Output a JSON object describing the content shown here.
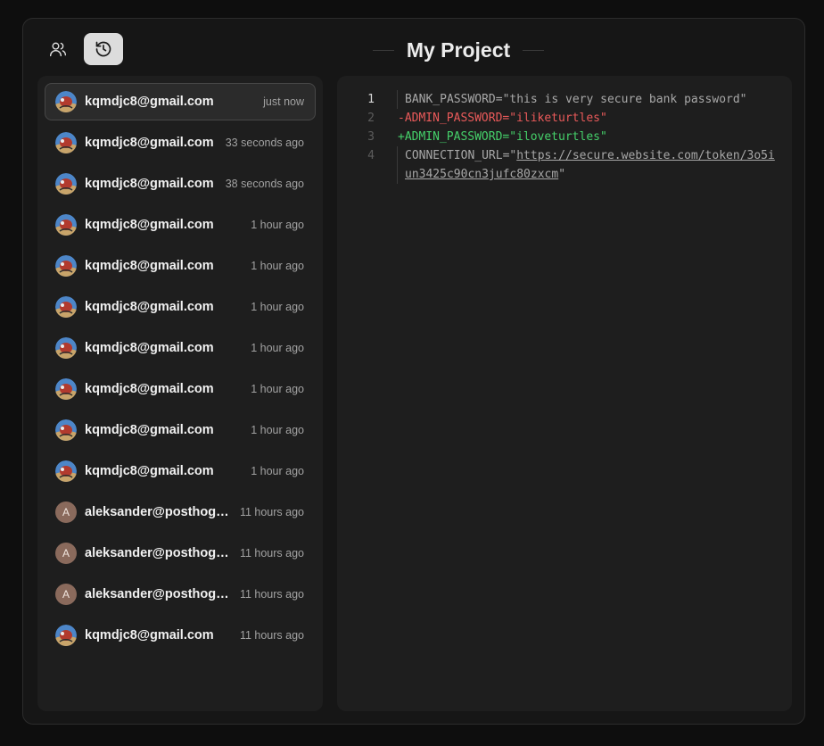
{
  "header": {
    "title": "My Project",
    "users_icon": "users-icon",
    "history_icon": "history-icon"
  },
  "history": {
    "items": [
      {
        "email": "kqmdjc8@gmail.com",
        "time": "just now",
        "avatar": "image",
        "active": true
      },
      {
        "email": "kqmdjc8@gmail.com",
        "time": "33 seconds ago",
        "avatar": "image"
      },
      {
        "email": "kqmdjc8@gmail.com",
        "time": "38 seconds ago",
        "avatar": "image"
      },
      {
        "email": "kqmdjc8@gmail.com",
        "time": "1 hour ago",
        "avatar": "image"
      },
      {
        "email": "kqmdjc8@gmail.com",
        "time": "1 hour ago",
        "avatar": "image"
      },
      {
        "email": "kqmdjc8@gmail.com",
        "time": "1 hour ago",
        "avatar": "image"
      },
      {
        "email": "kqmdjc8@gmail.com",
        "time": "1 hour ago",
        "avatar": "image"
      },
      {
        "email": "kqmdjc8@gmail.com",
        "time": "1 hour ago",
        "avatar": "image"
      },
      {
        "email": "kqmdjc8@gmail.com",
        "time": "1 hour ago",
        "avatar": "image"
      },
      {
        "email": "kqmdjc8@gmail.com",
        "time": "1 hour ago",
        "avatar": "image"
      },
      {
        "email": "aleksander@posthog.c...",
        "time": "11 hours ago",
        "avatar": "letter",
        "initial": "A"
      },
      {
        "email": "aleksander@posthog.c...",
        "time": "11 hours ago",
        "avatar": "letter",
        "initial": "A"
      },
      {
        "email": "aleksander@posthog.c...",
        "time": "11 hours ago",
        "avatar": "letter",
        "initial": "A"
      },
      {
        "email": "kqmdjc8@gmail.com",
        "time": "11 hours ago",
        "avatar": "image"
      }
    ]
  },
  "diff": {
    "lines": [
      {
        "num": "1",
        "type": "context",
        "text": "BANK_PASSWORD=\"this is very secure bank password\"",
        "current": true
      },
      {
        "num": "2",
        "type": "removed",
        "text": "-ADMIN_PASSWORD=\"iliketurtles\""
      },
      {
        "num": "3",
        "type": "added",
        "text": "+ADMIN_PASSWORD=\"iloveturtles\""
      },
      {
        "num": "4",
        "type": "context",
        "prefix": "CONNECTION_URL=\"",
        "url": "https://secure.website.com/token/3o5iun3425c90cn3jufc80zxcm",
        "suffix": "\""
      }
    ]
  },
  "colors": {
    "background": "#0e0e0e",
    "panel": "#1e1e1e",
    "removed": "#ea5a5a",
    "added": "#45d06a"
  }
}
